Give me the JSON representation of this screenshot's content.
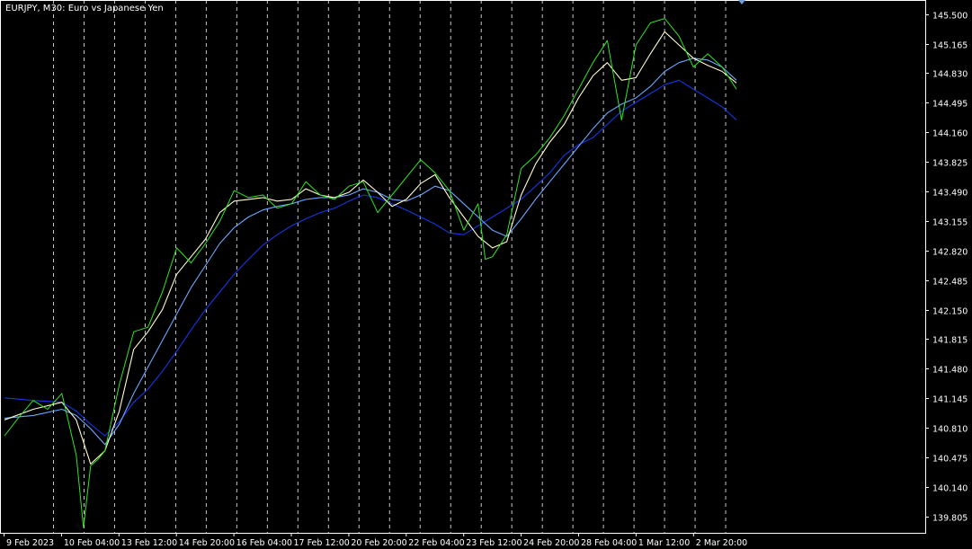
{
  "window": {
    "symbol_title": "EURJPY, M30:  Euro vs Japanese Yen"
  },
  "colors": {
    "background": "#000000",
    "axis": "#ffffff",
    "grid": "#c8c8c8",
    "price": "#2ee61e",
    "ma_fast": "#fffbd0",
    "ma_mid": "#6aa8ff",
    "ma_slow": "#1437e6",
    "marker": "#6f9fd6"
  },
  "chart_data": {
    "type": "line",
    "title": "EURJPY, M30:  Euro vs Japanese Yen",
    "ylim": [
      139.62,
      145.66
    ],
    "y_ticks": [
      "145.500",
      "145.165",
      "144.830",
      "144.495",
      "144.160",
      "143.825",
      "143.490",
      "143.155",
      "142.820",
      "142.485",
      "142.150",
      "141.815",
      "141.480",
      "141.145",
      "140.810",
      "140.475",
      "140.140",
      "139.805"
    ],
    "x_tick_labels": [
      "9 Feb 2023",
      "10 Feb 04:00",
      "13 Feb 12:00",
      "14 Feb 20:00",
      "16 Feb 04:00",
      "17 Feb 12:00",
      "20 Feb 20:00",
      "22 Feb 04:00",
      "23 Feb 12:00",
      "24 Feb 20:00",
      "28 Feb 04:00",
      "1 Mar 12:00",
      "2 Mar 20:00"
    ],
    "grid": "vertical dashed",
    "x_range": [
      0,
      103
    ],
    "series": [
      {
        "name": "",
        "color_key": "price",
        "x": [
          0,
          2,
          4,
          6,
          8,
          10,
          11,
          12,
          13,
          14,
          16,
          18,
          20,
          22,
          24,
          26,
          28,
          30,
          32,
          34,
          36,
          38,
          40,
          42,
          44,
          46,
          48,
          50,
          52,
          54,
          56,
          58,
          60,
          62,
          64,
          66,
          67,
          68,
          70,
          72,
          74,
          76,
          78,
          80,
          82,
          84,
          86,
          88,
          90,
          92,
          94,
          96,
          98,
          100,
          102
        ],
        "y": [
          140.72,
          140.93,
          141.12,
          141.02,
          141.2,
          140.5,
          139.68,
          140.38,
          140.45,
          140.55,
          141.3,
          141.9,
          141.95,
          142.35,
          142.85,
          142.68,
          142.9,
          143.15,
          143.5,
          143.42,
          143.45,
          143.3,
          143.35,
          143.6,
          143.45,
          143.4,
          143.55,
          143.6,
          143.25,
          143.45,
          143.65,
          143.85,
          143.7,
          143.5,
          143.05,
          143.35,
          142.72,
          142.75,
          143.0,
          143.75,
          143.9,
          144.1,
          144.35,
          144.65,
          144.95,
          145.2,
          144.3,
          145.15,
          145.4,
          145.45,
          145.25,
          144.9,
          145.05,
          144.9,
          144.65
        ]
      },
      {
        "name": "",
        "color_key": "ma_fast",
        "x": [
          0,
          4,
          8,
          10,
          12,
          14,
          16,
          18,
          20,
          22,
          24,
          26,
          28,
          30,
          32,
          34,
          36,
          38,
          40,
          42,
          44,
          46,
          48,
          50,
          52,
          54,
          56,
          58,
          60,
          62,
          64,
          66,
          68,
          70,
          72,
          74,
          76,
          78,
          80,
          82,
          84,
          86,
          88,
          90,
          92,
          94,
          96,
          98,
          100,
          102
        ],
        "y": [
          140.9,
          141.02,
          141.1,
          140.9,
          140.4,
          140.55,
          141.0,
          141.7,
          141.9,
          142.15,
          142.55,
          142.75,
          142.95,
          143.25,
          143.38,
          143.4,
          143.42,
          143.38,
          143.4,
          143.52,
          143.45,
          143.42,
          143.48,
          143.62,
          143.48,
          143.32,
          143.4,
          143.58,
          143.68,
          143.42,
          143.2,
          142.98,
          142.85,
          142.92,
          143.45,
          143.8,
          144.05,
          144.25,
          144.55,
          144.8,
          144.95,
          144.75,
          144.78,
          145.05,
          145.3,
          145.15,
          145.0,
          144.92,
          144.85,
          144.72
        ]
      },
      {
        "name": "",
        "color_key": "ma_mid",
        "x": [
          0,
          4,
          8,
          10,
          12,
          14,
          16,
          18,
          20,
          22,
          24,
          26,
          28,
          30,
          32,
          34,
          36,
          38,
          40,
          42,
          44,
          46,
          48,
          50,
          52,
          54,
          56,
          58,
          60,
          62,
          64,
          66,
          68,
          70,
          72,
          74,
          76,
          78,
          80,
          82,
          84,
          86,
          88,
          90,
          92,
          94,
          96,
          98,
          100,
          102
        ],
        "y": [
          140.92,
          140.95,
          141.02,
          140.95,
          140.8,
          140.62,
          140.85,
          141.2,
          141.5,
          141.8,
          142.1,
          142.4,
          142.65,
          142.9,
          143.08,
          143.2,
          143.28,
          143.32,
          143.35,
          143.4,
          143.42,
          143.42,
          143.45,
          143.52,
          143.48,
          143.4,
          143.38,
          143.45,
          143.55,
          143.5,
          143.35,
          143.2,
          143.05,
          142.98,
          143.18,
          143.4,
          143.6,
          143.8,
          144.0,
          144.2,
          144.38,
          144.48,
          144.55,
          144.68,
          144.85,
          144.95,
          145.0,
          144.98,
          144.9,
          144.75
        ]
      },
      {
        "name": "",
        "color_key": "ma_slow",
        "x": [
          0,
          4,
          8,
          10,
          12,
          14,
          16,
          18,
          20,
          22,
          24,
          26,
          28,
          30,
          32,
          34,
          36,
          38,
          40,
          42,
          44,
          46,
          48,
          50,
          52,
          54,
          56,
          58,
          60,
          62,
          64,
          66,
          68,
          70,
          72,
          74,
          76,
          78,
          80,
          82,
          84,
          86,
          88,
          90,
          92,
          94,
          96,
          98,
          100,
          102
        ],
        "y": [
          141.15,
          141.12,
          141.1,
          141.0,
          140.85,
          140.72,
          140.88,
          141.1,
          141.25,
          141.45,
          141.68,
          141.92,
          142.15,
          142.35,
          142.55,
          142.72,
          142.88,
          143.0,
          143.1,
          143.18,
          143.25,
          143.3,
          143.38,
          143.45,
          143.42,
          143.35,
          143.28,
          143.2,
          143.12,
          143.02,
          143.0,
          143.1,
          143.2,
          143.3,
          143.4,
          143.55,
          143.7,
          143.9,
          144.02,
          144.1,
          144.25,
          144.4,
          144.5,
          144.6,
          144.7,
          144.75,
          144.65,
          144.55,
          144.45,
          144.3
        ]
      }
    ]
  }
}
